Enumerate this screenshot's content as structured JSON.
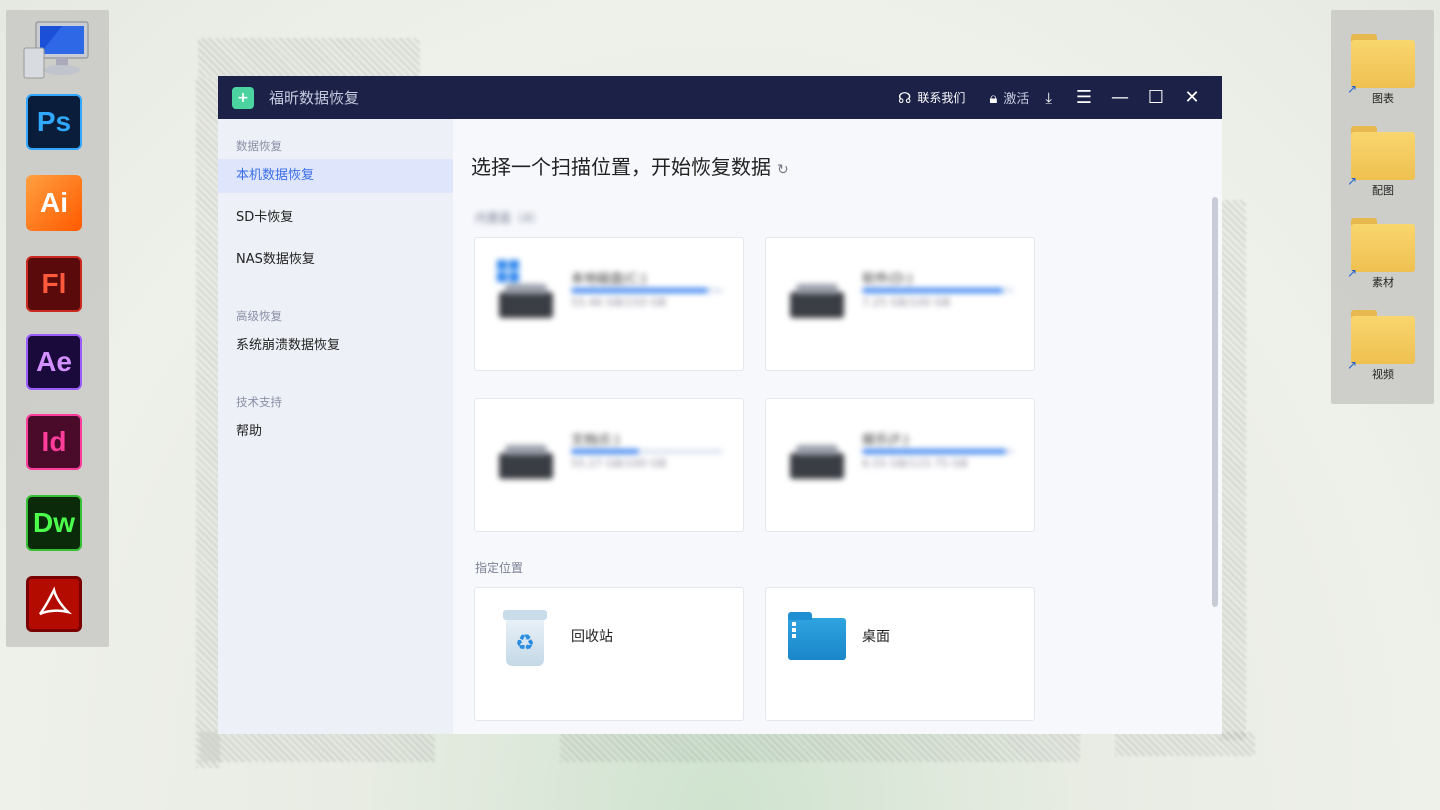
{
  "desktop": {
    "left_dock": [
      "Ps",
      "Ai",
      "Fl",
      "Ae",
      "Id",
      "Dw"
    ],
    "right_folders": [
      "图表",
      "配图",
      "素材",
      "视频"
    ]
  },
  "app": {
    "title": "福昕数据恢复",
    "toolbar": {
      "contact": "联系我们",
      "activate": "激活"
    },
    "sidebar": {
      "section_recovery": "数据恢复",
      "items": [
        "本机数据恢复",
        "SD卡恢复",
        "NAS数据恢复"
      ],
      "section_advanced": "高级恢复",
      "advanced_item": "系统崩溃数据恢复",
      "section_support": "技术支持",
      "support_item": "帮助"
    },
    "main": {
      "title": "选择一个扫描位置，开始恢复数据",
      "disks_label": "内置盘（4）",
      "disks": [
        {
          "name": "本地磁盘(C:)",
          "size": "55.46 GB/150 GB",
          "usage": 0.9
        },
        {
          "name": "软件(D:)",
          "size": "7.25 GB/100 GB",
          "usage": 0.93
        },
        {
          "name": "文档(E:)",
          "size": "55.27 GB/100 GB",
          "usage": 0.45
        },
        {
          "name": "娱乐(F:)",
          "size": "6.55 GB/115.75 GB",
          "usage": 0.95
        }
      ],
      "locations_label": "指定位置",
      "locations": [
        "回收站",
        "桌面"
      ]
    },
    "colors": {
      "titlebar": "#1b2147",
      "accent": "#3a6ee8",
      "sidebar_bg": "#eef0f8"
    }
  }
}
